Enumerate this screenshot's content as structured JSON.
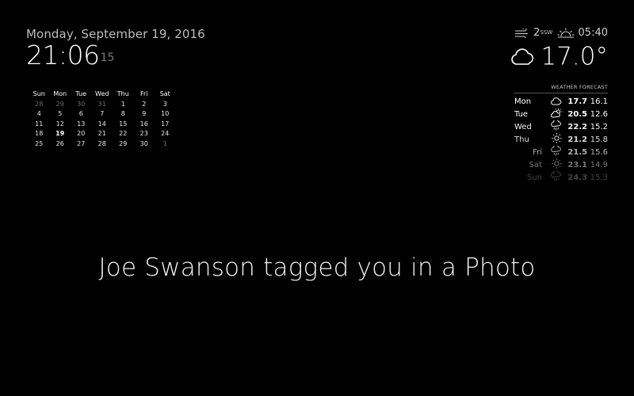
{
  "clock": {
    "date": "Monday, September 19, 2016",
    "time": "21:06",
    "seconds": "15"
  },
  "calendar": {
    "weekdays": [
      "Sun",
      "Mon",
      "Tue",
      "Wed",
      "Thu",
      "Fri",
      "Sat"
    ],
    "weeks": [
      [
        "28",
        "29",
        "30",
        "31",
        "1",
        "2",
        "3"
      ],
      [
        "4",
        "5",
        "6",
        "7",
        "8",
        "9",
        "10"
      ],
      [
        "11",
        "12",
        "13",
        "14",
        "15",
        "16",
        "17"
      ],
      [
        "18",
        "19",
        "20",
        "21",
        "22",
        "23",
        "24"
      ],
      [
        "25",
        "26",
        "27",
        "28",
        "29",
        "30",
        "1"
      ]
    ],
    "today": "19"
  },
  "current_weather": {
    "wind_speed": "2",
    "wind_direction": "SSW",
    "sunrise_time": "05:40",
    "temperature": "17.0°",
    "condition_icon": "cloudy-icon"
  },
  "forecast": {
    "header": "WEATHER FORECAST",
    "days": [
      {
        "day": "Mon",
        "icon": "cloudy-icon",
        "max": "17.7",
        "min": "16.1"
      },
      {
        "day": "Tue",
        "icon": "partly-cloudy-icon",
        "max": "20.5",
        "min": "12.6"
      },
      {
        "day": "Wed",
        "icon": "rain-icon",
        "max": "22.2",
        "min": "15.2"
      },
      {
        "day": "Thu",
        "icon": "sunny-icon",
        "max": "21.2",
        "min": "15.8"
      },
      {
        "day": "Fri",
        "icon": "rain-icon",
        "max": "21.5",
        "min": "15.6"
      },
      {
        "day": "Sat",
        "icon": "sunny-icon",
        "max": "23.1",
        "min": "14.9"
      },
      {
        "day": "Sun",
        "icon": "rain-icon",
        "max": "24.3",
        "min": "15.3"
      }
    ]
  },
  "notification": {
    "text": "Joe Swanson tagged you in a Photo"
  }
}
